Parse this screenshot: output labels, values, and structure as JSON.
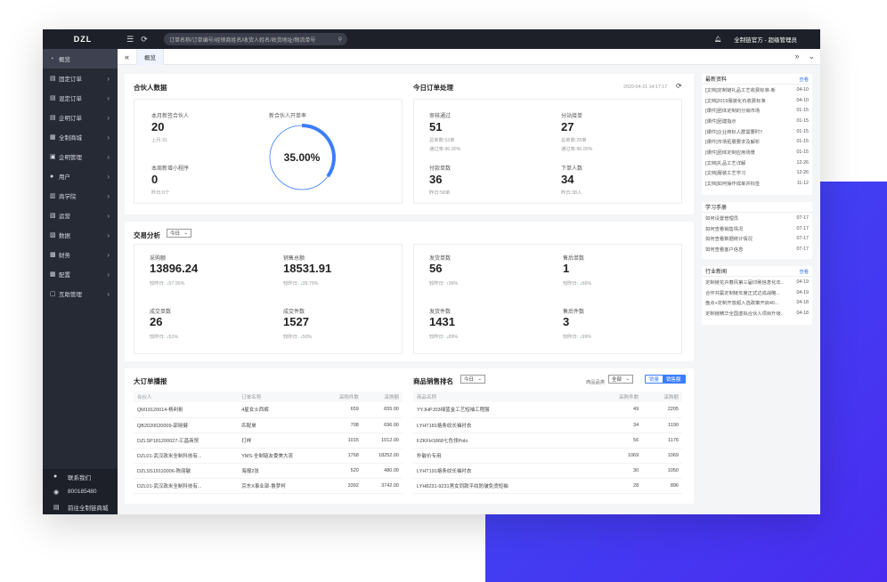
{
  "topbar": {
    "logo": "DZL",
    "search_placeholder": "订单名称/订单编号/经销商姓名/收货人姓名/收货地址/物流单号",
    "user": "全制链官方 - 超级管理员"
  },
  "sidebar": {
    "items": [
      {
        "label": "概览",
        "icon": "dashboard-icon",
        "active": true
      },
      {
        "label": "固定订单",
        "icon": "doc-icon"
      },
      {
        "label": "混定订单",
        "icon": "doc-icon"
      },
      {
        "label": "企明订单",
        "icon": "doc-icon"
      },
      {
        "label": "全制商城",
        "icon": "shop-icon"
      },
      {
        "label": "企明管理",
        "icon": "manage-icon"
      },
      {
        "label": "用户",
        "icon": "user-icon"
      },
      {
        "label": "商学院",
        "icon": "school-icon"
      },
      {
        "label": "运营",
        "icon": "operation-icon"
      },
      {
        "label": "数据",
        "icon": "data-icon"
      },
      {
        "label": "财务",
        "icon": "finance-icon"
      },
      {
        "label": "配置",
        "icon": "config-icon"
      },
      {
        "label": "互助管理",
        "icon": "help-icon"
      }
    ],
    "bottom": [
      {
        "label": "联系我们",
        "icon": "contact-icon"
      },
      {
        "label": "800185480",
        "icon": "phone-icon"
      },
      {
        "label": "前往全制链商城",
        "icon": "store-icon"
      }
    ]
  },
  "tabs": {
    "active": "概览"
  },
  "partner": {
    "title": "合伙人数据",
    "month_label": "本月新签合伙人",
    "month_value": "20",
    "month_sub": "上月:31",
    "week_label": "本周新增小程序",
    "week_value": "0",
    "week_sub": "昨日:0个",
    "rate_label": "新合伙人开单率",
    "rate_value": "35.00%",
    "rate": 0.35
  },
  "orders": {
    "title": "今日订单处理",
    "time": "2020-04-21 14:17:17",
    "items": [
      {
        "label": "审核通过",
        "value": "51",
        "sub": "总单数:53单",
        "sub2": "通过率:96.00%"
      },
      {
        "label": "分站接单",
        "value": "27",
        "sub": "总单数:28单",
        "sub2": "通过率:96.00%"
      },
      {
        "label": "付款单数",
        "value": "36",
        "sub": "昨日:58单"
      },
      {
        "label": "下单人数",
        "value": "34",
        "sub": "昨日:38人"
      }
    ]
  },
  "trade": {
    "title": "交易分析",
    "period": "今日",
    "left": [
      {
        "label": "采购额",
        "value": "13896.24",
        "cmp": "较昨日:",
        "dir": "down",
        "pct": "57.95%"
      },
      {
        "label": "销售总额",
        "value": "18531.91",
        "cmp": "较昨日:",
        "dir": "down",
        "pct": "39.79%"
      },
      {
        "label": "成交单数",
        "value": "26",
        "cmp": "较昨日:",
        "dir": "down",
        "pct": "51%"
      },
      {
        "label": "成交件数",
        "value": "1527",
        "cmp": "较昨日:",
        "dir": "down",
        "pct": "50%"
      }
    ],
    "right": [
      {
        "label": "发货单数",
        "value": "56",
        "cmp": "较昨日:",
        "dir": "up",
        "pct": "36%"
      },
      {
        "label": "售后单数",
        "value": "1",
        "cmp": "较昨日:",
        "dir": "down",
        "pct": "66%"
      },
      {
        "label": "发货件数",
        "value": "1431",
        "cmp": "较昨日:",
        "dir": "down",
        "pct": "89%"
      },
      {
        "label": "售后件数",
        "value": "3",
        "cmp": "较昨日:",
        "dir": "down",
        "pct": "99%"
      }
    ]
  },
  "big_orders": {
    "title": "大订单播报",
    "headers": [
      "合伙人",
      "订单名称",
      "采购件数",
      "采购额"
    ],
    "rows": [
      [
        "QM19120014-杨利彬",
        "4星女士西裤",
        "659",
        "655.00"
      ],
      [
        "QB2020020009-邵晓健",
        "匹配单",
        "708",
        "696.00"
      ],
      [
        "DZLSP181200027-汇昌商贸",
        "打样",
        "1015",
        "1012.00"
      ],
      [
        "DZL01-武汉政米全制科技有...",
        "YMS-全制链友委美大流",
        "1768",
        "18252.00"
      ],
      [
        "DZLSS19110006-陈丽敏",
        "海报2张",
        "520",
        "480.00"
      ],
      [
        "DZL01-武汉政米全制科技有...",
        "京东X事业部-鲁梦柯",
        "3392",
        "3742.00"
      ]
    ]
  },
  "ranking": {
    "title": "商品销售排名",
    "period": "今日",
    "brand_label": "商品品类",
    "brand_value": "全部",
    "toggle": [
      "销量",
      "销售额"
    ],
    "headers": [
      "商品名称",
      "采购件数",
      "采购额"
    ],
    "rows": [
      [
        "YYJHPJ03绿蓝金工艺短袖工程服",
        "49",
        "2205"
      ],
      [
        "LYHT181格条纹长袖衬衣",
        "34",
        "1190"
      ],
      [
        "FZKFH1868七色领Polo",
        "56",
        "1176"
      ],
      [
        "朴敏价专用",
        "1069",
        "1069"
      ],
      [
        "LYHT191格条纹长袖衬衣",
        "30",
        "1050"
      ],
      [
        "LYH8231-9231男女同款平纹防皱免烫短袖",
        "28",
        "896"
      ]
    ]
  },
  "news": {
    "title": "最新资料",
    "more": "查看",
    "rows": [
      [
        "[文档]定制链礼品工艺收费标准-新",
        "04-10"
      ],
      [
        "[文档]2019服装化石收费标准",
        "04-10"
      ],
      [
        "[课件]团体定制的分销市场",
        "01-15"
      ],
      [
        "[课件]团建指示",
        "01-15"
      ],
      [
        "[课件]企业商标人群需要时？",
        "01-15"
      ],
      [
        "[课件]市场拓展要求及解析",
        "01-15"
      ],
      [
        "[课件]团体定制应用场景",
        "01-15"
      ],
      [
        "[文档]礼品工艺详解",
        "12-26"
      ],
      [
        "[文档]服装工艺学习",
        "12-26"
      ],
      [
        "[文档]如何操作成单并标签",
        "11-12"
      ]
    ]
  },
  "study": {
    "title": "学习手册",
    "more": "",
    "rows": [
      [
        "如何设置管理员",
        "07-17"
      ],
      [
        "如何查看销售情况",
        "07-17"
      ],
      [
        "如何查看数据统计情况",
        "07-17"
      ],
      [
        "如何查看客户信息",
        "07-17"
      ]
    ]
  },
  "industry": {
    "title": "行业新闻",
    "more": "查看",
    "rows": [
      [
        "定制链花卉春风第三届印刷信息化年...",
        "04-19"
      ],
      [
        "合作共赢定制链年度正式达成战略...",
        "04-19"
      ],
      [
        "盘点+定制开放超入选政策开启40...",
        "04-18"
      ],
      [
        "定制链精华全国虚拟合伙人项目升级...",
        "04-18"
      ]
    ]
  },
  "colors": {
    "accent": "#3c7dff",
    "sidebar": "#262a35",
    "topbar": "#1d2029",
    "up": "#e8453c",
    "down": "#2bb673"
  }
}
